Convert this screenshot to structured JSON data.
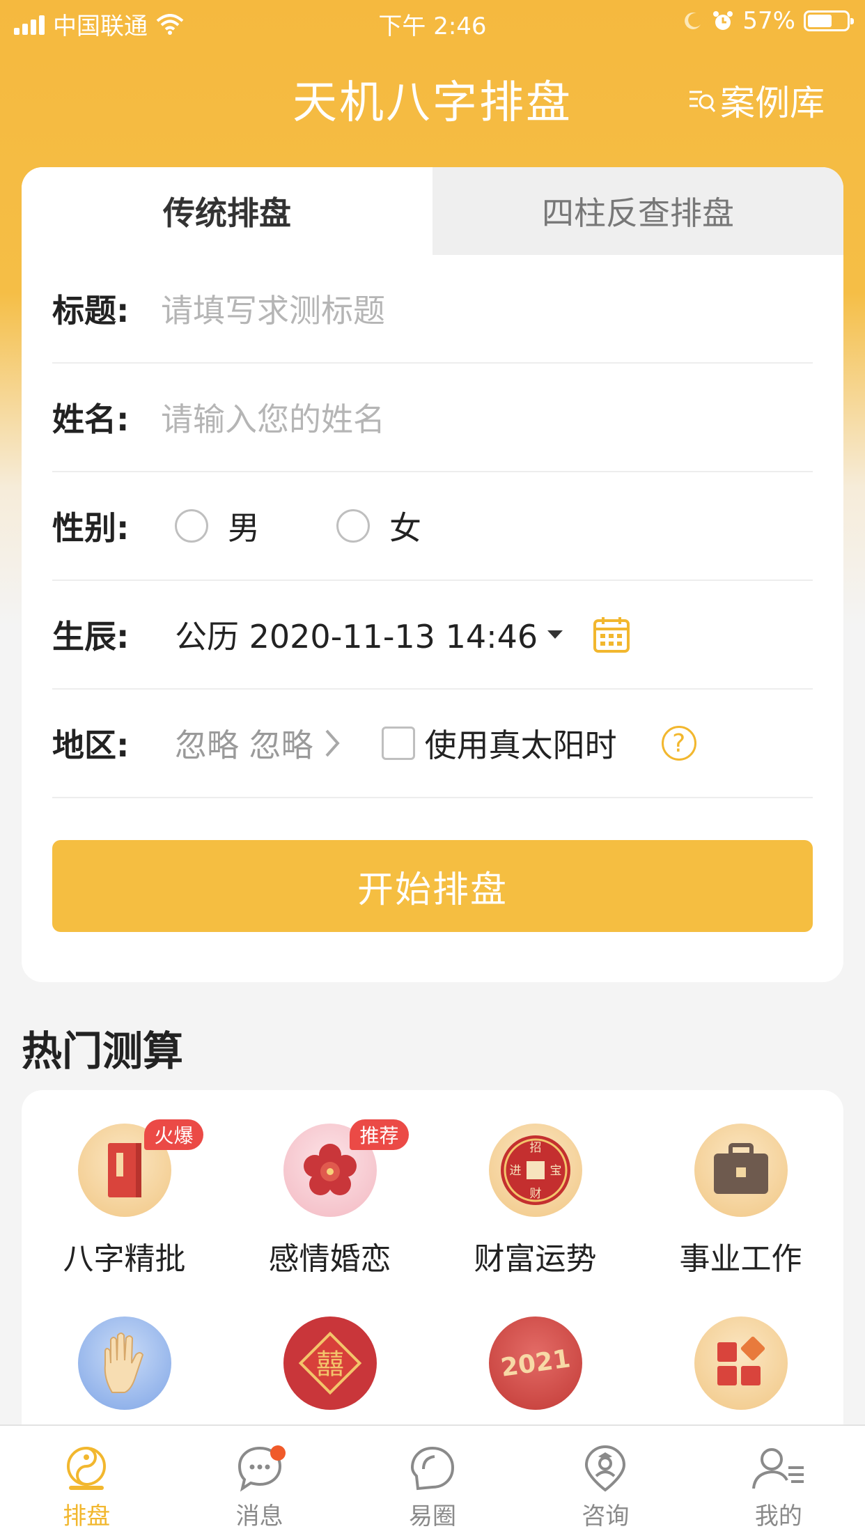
{
  "status_bar": {
    "carrier": "中国联通",
    "time": "下午 2:46",
    "battery_percent": "57%",
    "battery_level": 0.57
  },
  "header": {
    "title": "天机八字排盘",
    "case_library": "案例库"
  },
  "form": {
    "tabs": [
      {
        "label": "传统排盘",
        "active": true
      },
      {
        "label": "四柱反查排盘",
        "active": false
      }
    ],
    "title_field": {
      "label": "标题:",
      "placeholder": "请填写求测标题"
    },
    "name_field": {
      "label": "姓名:",
      "placeholder": "请输入您的姓名"
    },
    "gender": {
      "label": "性别:",
      "options": [
        "男",
        "女"
      ]
    },
    "birth": {
      "label": "生辰:",
      "value": "公历 2020-11-13 14:46"
    },
    "region": {
      "label": "地区:",
      "value": "忽略 忽略",
      "true_solar_label": "使用真太阳时",
      "help": "?"
    },
    "submit": "开始排盘"
  },
  "hot": {
    "title": "热门测算",
    "items": [
      {
        "label": "八字精批",
        "badge": "火爆"
      },
      {
        "label": "感情婚恋",
        "badge": "推荐"
      },
      {
        "label": "财富运势",
        "badge": ""
      },
      {
        "label": "事业工作",
        "badge": ""
      }
    ],
    "wealth_icon_chars": [
      "招",
      "进",
      "宝",
      "财"
    ],
    "xi_char": "囍",
    "year_text": "2021"
  },
  "tab_bar": [
    {
      "label": "排盘",
      "active": true
    },
    {
      "label": "消息",
      "active": false
    },
    {
      "label": "易圈",
      "active": false
    },
    {
      "label": "咨询",
      "active": false
    },
    {
      "label": "我的",
      "active": false
    }
  ],
  "colors": {
    "accent": "#F5BE41",
    "badge_red": "#EB4A46",
    "active_tab": "#F2B72E"
  }
}
